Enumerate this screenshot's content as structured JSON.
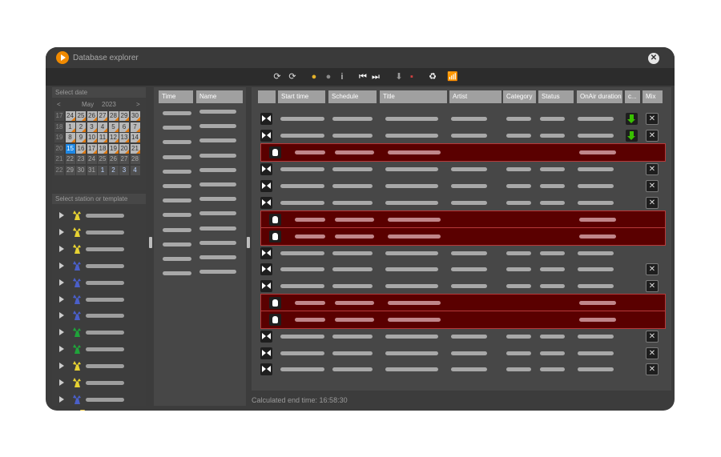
{
  "window": {
    "title": "Database explorer",
    "close_glyph": "✕"
  },
  "toolbar": [
    {
      "icon": "clock-add-icon",
      "glyph": "⟳"
    },
    {
      "icon": "clock-refresh-icon",
      "glyph": "⟳"
    },
    {
      "icon": "record-icon",
      "glyph": "●"
    },
    {
      "icon": "record-disabled-icon",
      "glyph": "●"
    },
    {
      "icon": "info-icon",
      "glyph": "i"
    },
    {
      "icon": "skip-first-icon",
      "glyph": "⏮"
    },
    {
      "icon": "skip-last-icon",
      "glyph": "⏭"
    },
    {
      "icon": "move-down-icon",
      "glyph": "⬇"
    },
    {
      "icon": "colors-icon",
      "glyph": "▪"
    },
    {
      "icon": "recycle-icon",
      "glyph": "♻"
    },
    {
      "icon": "signal-icon",
      "glyph": "📶"
    }
  ],
  "calendar": {
    "label": "Select date",
    "prev": "<",
    "next": ">",
    "month": "May",
    "year": "2023",
    "weeks": [
      {
        "wk": "17",
        "days": [
          "24",
          "25",
          "26",
          "27",
          "28",
          "29",
          "30"
        ]
      },
      {
        "wk": "18",
        "days": [
          "1",
          "2",
          "3",
          "4",
          "5",
          "6",
          "7"
        ]
      },
      {
        "wk": "19",
        "days": [
          "8",
          "9",
          "10",
          "11",
          "12",
          "13",
          "14"
        ]
      },
      {
        "wk": "20",
        "days": [
          "15",
          "16",
          "17",
          "18",
          "19",
          "20",
          "21"
        ]
      },
      {
        "wk": "21",
        "days": [
          "22",
          "23",
          "24",
          "25",
          "26",
          "27",
          "28"
        ]
      },
      {
        "wk": "22",
        "days": [
          "29",
          "30",
          "31",
          "1",
          "2",
          "3",
          "4"
        ]
      }
    ],
    "selected_day": "15"
  },
  "stations": {
    "label": "Select station or template",
    "items": [
      {
        "icon": "tower-yellow-icon",
        "color": "#e7d232"
      },
      {
        "icon": "tower-yellow-icon",
        "color": "#e7d232"
      },
      {
        "icon": "tower-yellow-icon",
        "color": "#e7d232"
      },
      {
        "icon": "tower-blue-icon",
        "color": "#4a5fc9"
      },
      {
        "icon": "tower-blue-icon",
        "color": "#4a5fc9"
      },
      {
        "icon": "tower-blue-icon",
        "color": "#4a5fc9"
      },
      {
        "icon": "tower-blue-icon",
        "color": "#4a5fc9"
      },
      {
        "icon": "tower-green-icon",
        "color": "#1fa33a"
      },
      {
        "icon": "tower-green-icon",
        "color": "#1fa33a"
      },
      {
        "icon": "tower-yellow-icon",
        "color": "#e7d232"
      },
      {
        "icon": "tower-yellow-icon",
        "color": "#e7d232"
      },
      {
        "icon": "tower-blue-icon",
        "color": "#4a5fc9"
      },
      {
        "icon": "folder-icon",
        "color": "#f3cf4a"
      }
    ]
  },
  "schedule_list": {
    "columns": [
      "Time",
      "Name"
    ],
    "row_count": 12
  },
  "grid": {
    "columns": [
      "",
      "Start time",
      "Schedule",
      "Title",
      "Artist",
      "Category",
      "Status",
      "OnAir duration",
      "c...",
      "Mix"
    ],
    "rows": [
      {
        "type": "normal",
        "download": true,
        "mix": true
      },
      {
        "type": "normal",
        "download": true,
        "mix": true
      },
      {
        "type": "live",
        "download": false,
        "mix": false
      },
      {
        "type": "normal",
        "download": false,
        "mix": true
      },
      {
        "type": "normal",
        "download": false,
        "mix": true
      },
      {
        "type": "normal",
        "download": false,
        "mix": true
      },
      {
        "type": "live",
        "download": false,
        "mix": false
      },
      {
        "type": "live",
        "download": false,
        "mix": false
      },
      {
        "type": "normal",
        "download": false,
        "mix": false
      },
      {
        "type": "normal",
        "download": false,
        "mix": true
      },
      {
        "type": "normal",
        "download": false,
        "mix": true
      },
      {
        "type": "live",
        "download": false,
        "mix": false
      },
      {
        "type": "live",
        "download": false,
        "mix": false
      },
      {
        "type": "normal",
        "download": false,
        "mix": true
      },
      {
        "type": "normal",
        "download": false,
        "mix": true
      },
      {
        "type": "normal",
        "download": false,
        "mix": true
      }
    ],
    "mix_glyph": "✕"
  },
  "status": {
    "end_time": "Calculated end time: 16:58:30"
  },
  "colors": {
    "window_bg": "#3c3c3c",
    "live_row": "#5a0000",
    "accent_orange": "#f08a00",
    "today_blue": "#1e88e5",
    "download_green": "#39c000"
  }
}
